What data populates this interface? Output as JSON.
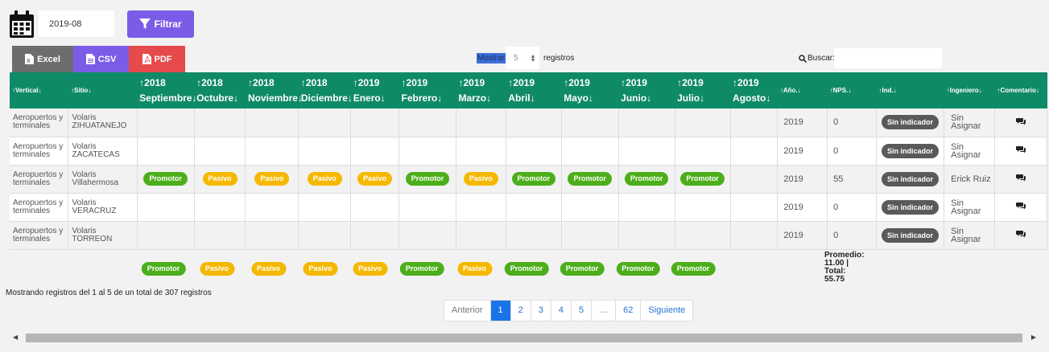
{
  "filter": {
    "date_value": "2019-08",
    "filter_label": "Filtrar"
  },
  "export": {
    "excel": "Excel",
    "csv": "CSV",
    "pdf": "PDF"
  },
  "length": {
    "prefix": "Mostrar",
    "value": "5",
    "suffix": "registros"
  },
  "search": {
    "label": "Buscar:",
    "value": ""
  },
  "table": {
    "headers": {
      "vertical": "Vertical",
      "sitio": "Sitio",
      "months": [
        {
          "year": "2018",
          "month": "Septiembre"
        },
        {
          "year": "2018",
          "month": "Octubre"
        },
        {
          "year": "2018",
          "month": "Noviembre"
        },
        {
          "year": "2018",
          "month": "Diciembre"
        },
        {
          "year": "2019",
          "month": "Enero"
        },
        {
          "year": "2019",
          "month": "Febrero"
        },
        {
          "year": "2019",
          "month": "Marzo"
        },
        {
          "year": "2019",
          "month": "Abril"
        },
        {
          "year": "2019",
          "month": "Mayo"
        },
        {
          "year": "2019",
          "month": "Junio"
        },
        {
          "year": "2019",
          "month": "Julio"
        },
        {
          "year": "2019",
          "month": "Agosto"
        }
      ],
      "anio": "Año.",
      "nps": "NPS.",
      "ind": "Ind.",
      "ingeniero": "Ingeniero",
      "comentario": "Comentario"
    },
    "rows": [
      {
        "vertical": "Aeropuertos y terminales",
        "sitio": "Volaris ZIHUATANEJO",
        "months": [
          "",
          "",
          "",
          "",
          "",
          "",
          "",
          "",
          "",
          "",
          "",
          ""
        ],
        "anio": "2019",
        "nps": "0",
        "ind": "Sin indicador",
        "ingeniero": "Sin Asignar"
      },
      {
        "vertical": "Aeropuertos y terminales",
        "sitio": "Volaris ZACATECAS",
        "months": [
          "",
          "",
          "",
          "",
          "",
          "",
          "",
          "",
          "",
          "",
          "",
          ""
        ],
        "anio": "2019",
        "nps": "0",
        "ind": "Sin indicador",
        "ingeniero": "Sin Asignar"
      },
      {
        "vertical": "Aeropuertos y terminales",
        "sitio": "Volaris Villahermosa",
        "months": [
          "Promotor",
          "Pasivo",
          "Pasivo",
          "Pasivo",
          "Pasivo",
          "Promotor",
          "Pasivo",
          "Promotor",
          "Promotor",
          "Promotor",
          "Promotor",
          ""
        ],
        "anio": "2019",
        "nps": "55",
        "ind": "Sin indicador",
        "ingeniero": "Erick Ruiz"
      },
      {
        "vertical": "Aeropuertos y terminales",
        "sitio": "Volaris VERACRUZ",
        "months": [
          "",
          "",
          "",
          "",
          "",
          "",
          "",
          "",
          "",
          "",
          "",
          ""
        ],
        "anio": "2019",
        "nps": "0",
        "ind": "Sin indicador",
        "ingeniero": "Sin Asignar"
      },
      {
        "vertical": "Aeropuertos y terminales",
        "sitio": "Volaris TORREON",
        "months": [
          "",
          "",
          "",
          "",
          "",
          "",
          "",
          "",
          "",
          "",
          "",
          ""
        ],
        "anio": "2019",
        "nps": "0",
        "ind": "Sin indicador",
        "ingeniero": "Sin Asignar"
      }
    ],
    "footer_months": [
      "Promotor",
      "Pasivo",
      "Pasivo",
      "Pasivo",
      "Pasivo",
      "Promotor",
      "Pasivo",
      "Promotor",
      "Promotor",
      "Promotor",
      "Promotor"
    ],
    "summary": {
      "promedio": "Promedio:",
      "promedio_value": "11.00 |",
      "total": "Total:",
      "total_value": "55.75"
    }
  },
  "info": "Mostrando registros del 1 al 5 de un total de 307 registros",
  "pagination": [
    "Anterior",
    "1",
    "2",
    "3",
    "4",
    "5",
    "…",
    "62",
    "Siguiente"
  ],
  "colors": {
    "header": "#0f8a66",
    "promotor": "#4cae1a",
    "pasivo": "#f5b800",
    "accent": "#7b5ce6",
    "pdf": "#e64a4a"
  }
}
